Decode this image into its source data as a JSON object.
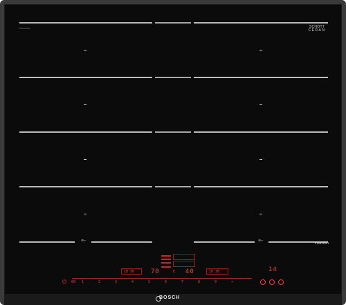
{
  "cooktop": {
    "glass_brand_line1": "SCHOTT",
    "glass_brand_line2": "CERAN",
    "glass_brand_line3": "",
    "small_tag": "FIXN/AN/36",
    "induction_label": "induction",
    "flex_marker_left": "≋⌐",
    "flex_marker_right": "≋⌐"
  },
  "controls": {
    "display_left": "70",
    "display_mid": "40",
    "display_right": "14",
    "timer_small_left": "10 50",
    "timer_small_right": "10 30",
    "mid_small": "E",
    "power_symbol": "⏻",
    "slider_prefix": "00",
    "slider_values": [
      "1",
      "2",
      "3",
      "4",
      "5",
      "6",
      "7",
      "8",
      "9",
      "+"
    ],
    "lock_symbol": "▢",
    "clock_symbol": "◷"
  },
  "brand": {
    "name": "BOSCH"
  },
  "colors": {
    "glass": "#0b0b0c",
    "frame": "#3a3a3a",
    "zone_lines": "#bdbdbd",
    "display_red": "#ff3b2f"
  }
}
